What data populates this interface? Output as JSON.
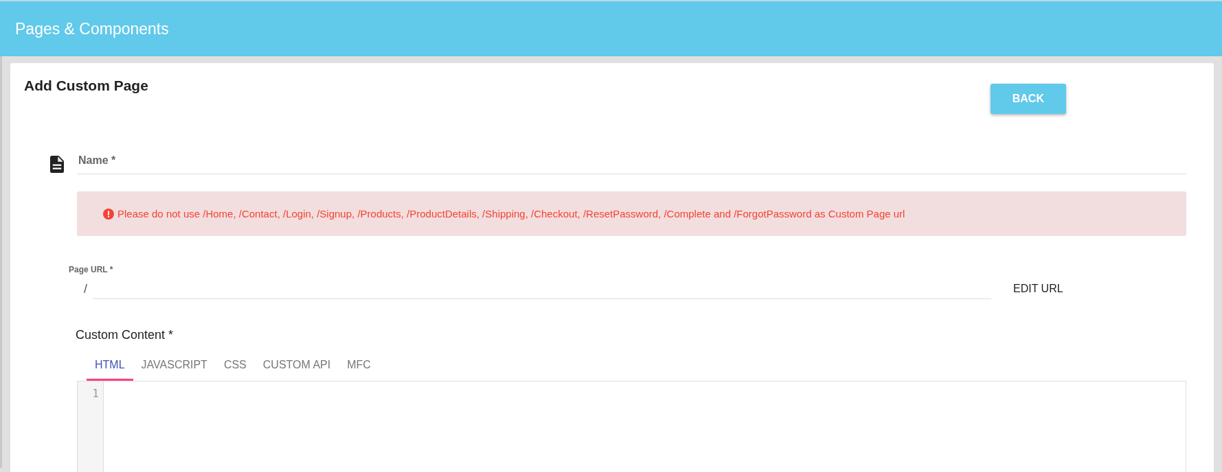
{
  "header": {
    "title": "Pages & Components"
  },
  "page": {
    "title": "Add Custom Page",
    "back_button": "BACK"
  },
  "name_field": {
    "placeholder": "Name *"
  },
  "alert": {
    "text": "Please do not use /Home, /Contact, /Login, /Signup, /Products, /ProductDetails, /Shipping, /Checkout, /ResetPassword, /Complete and /ForgotPassword as Custom Page url"
  },
  "url_field": {
    "label": "Page URL *",
    "prefix": "/",
    "edit_button": "EDIT URL"
  },
  "content": {
    "label": "Custom Content *",
    "tabs": [
      {
        "label": "HTML",
        "selected": true
      },
      {
        "label": "JAVASCRIPT",
        "selected": false
      },
      {
        "label": "CSS",
        "selected": false
      },
      {
        "label": "CUSTOM API",
        "selected": false
      },
      {
        "label": "MFC",
        "selected": false
      }
    ],
    "editor": {
      "line_numbers": [
        "1"
      ]
    }
  }
}
